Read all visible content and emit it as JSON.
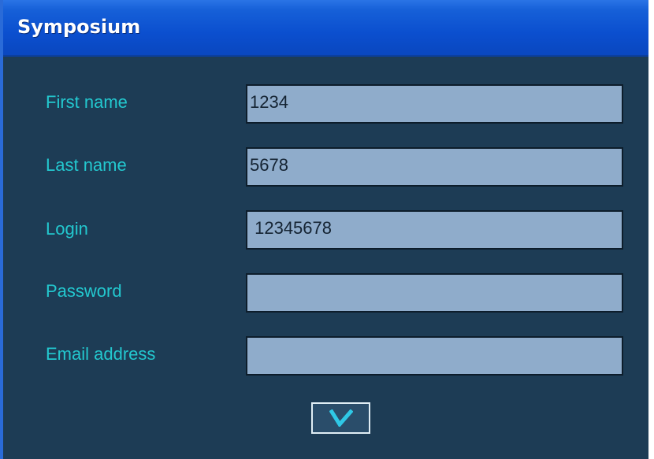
{
  "window": {
    "title": "Symposium"
  },
  "form": {
    "fields": [
      {
        "label": "First name",
        "value": "1234"
      },
      {
        "label": "Last name",
        "value": "5678"
      },
      {
        "label": "Login",
        "value": " 12345678"
      },
      {
        "label": "Password",
        "value": ""
      },
      {
        "label": "Email address",
        "value": ""
      }
    ],
    "submit_icon": "checkmark-icon"
  },
  "colors": {
    "background": "#1d3c55",
    "label": "#23c8cf",
    "input_fill": "#8faccb",
    "titlebar": "#0b4fcf",
    "check": "#2fc8e6"
  }
}
